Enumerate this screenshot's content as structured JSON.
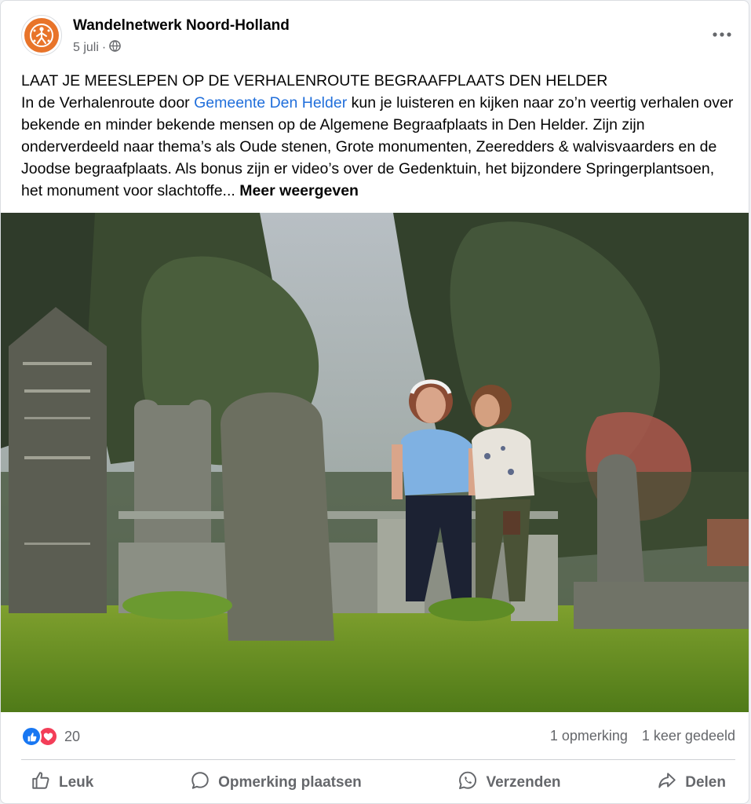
{
  "post": {
    "page_name": "Wandelnetwerk Noord-Holland",
    "date": "5 juli",
    "date_separator": "·",
    "audience_icon": "globe-icon",
    "more_icon": "more-options-icon",
    "headline": "LAAT JE MEESLEPEN OP DE VERHALENROUTE BEGRAAFPLAATS DEN HELDER",
    "body_before_link": "In de Verhalenroute door ",
    "body_link": "Gemeente Den Helder",
    "body_after_link": " kun je luisteren en kijken naar zo’n veertig verhalen over bekende en minder bekende mensen op de Algemene Begraafplaats in Den Helder. Zijn zijn onderverdeeld naar thema’s als Oude stenen, Grote monumenten, Zeeredders & walvisvaarders en de Joodse begraafplaats. Als bonus zijn er video’s over de Gedenktuin, het bijzondere Springerplantsoen, het monument voor slachtoffe... ",
    "see_more": "Meer weergeven",
    "link_color": "#216fdb",
    "image_alt_subject": "two-women-walking-in-cemetery-with-headphones"
  },
  "stats": {
    "reaction_icons": [
      "like-reaction-icon",
      "love-reaction-icon"
    ],
    "reaction_count": "20",
    "comments": "1 opmerking",
    "shares": "1 keer gedeeld"
  },
  "actions": {
    "like": "Leuk",
    "comment": "Opmerking plaatsen",
    "send": "Verzenden",
    "share": "Delen"
  },
  "colors": {
    "like_blue": "#1877f2",
    "love_red": "#f33e58",
    "avatar_orange": "#e8742a",
    "secondary_text": "#65676b"
  }
}
